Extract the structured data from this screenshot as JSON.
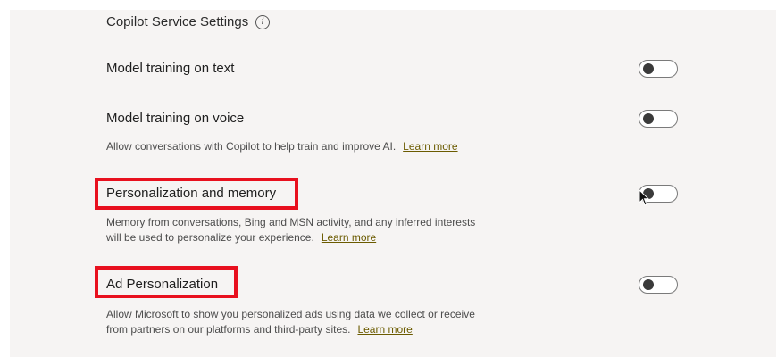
{
  "section": {
    "title": "Copilot Service Settings",
    "info_icon": "info-icon"
  },
  "settings": [
    {
      "label": "Model training on text",
      "enabled": false
    },
    {
      "label": "Model training on voice",
      "enabled": false,
      "description": "Allow conversations with Copilot to help train and improve AI.",
      "link": "Learn more"
    },
    {
      "label": "Personalization and memory",
      "enabled": false,
      "description_lines": [
        "Memory from conversations, Bing and MSN activity, and any inferred interests",
        "will be used to personalize your experience."
      ],
      "link": "Learn more"
    },
    {
      "label": "Ad Personalization",
      "enabled": false,
      "description_lines": [
        "Allow Microsoft to show you personalized ads using data we collect or receive",
        "from partners on our platforms and third-party sites."
      ],
      "link": "Learn more"
    }
  ],
  "colors": {
    "panel_bg": "#f6f4f3",
    "highlight": "#e8101e",
    "link": "#6b5b00"
  }
}
